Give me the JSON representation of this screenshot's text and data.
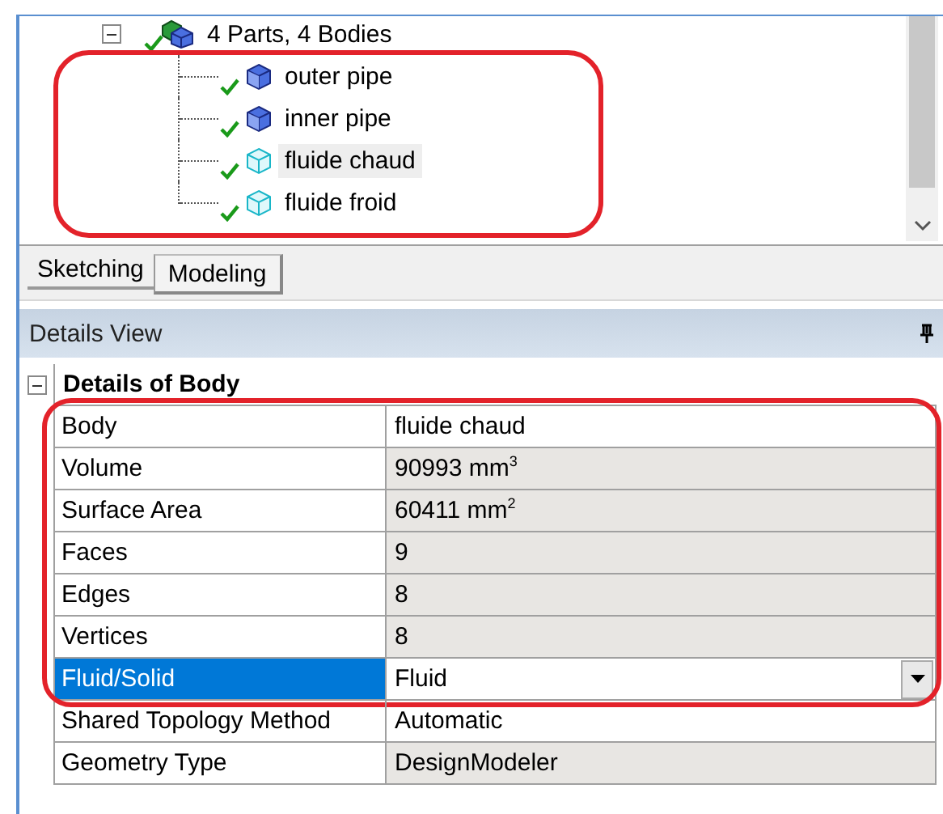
{
  "tree": {
    "outlined": true,
    "root": {
      "label": "4 Parts, 4 Bodies",
      "expanded": true,
      "children": [
        {
          "label": "outer pipe",
          "kind": "solid",
          "selected": false
        },
        {
          "label": "inner pipe",
          "kind": "solid",
          "selected": false
        },
        {
          "label": "fluide chaud",
          "kind": "fluid",
          "selected": true
        },
        {
          "label": "fluide froid",
          "kind": "fluid",
          "selected": false
        }
      ]
    }
  },
  "tabs": [
    {
      "label": "Sketching",
      "selected": false
    },
    {
      "label": "Modeling",
      "selected": true
    }
  ],
  "details_view": {
    "title": "Details View",
    "group": {
      "title": "Details of Body",
      "expanded": true,
      "sections": [
        {
          "outlined": true,
          "rows": [
            {
              "property": "Body",
              "value": "fluide chaud",
              "kind": "text",
              "readonly": false,
              "selected": false
            },
            {
              "property": "Volume",
              "value": "90993 mm$^{3}$",
              "kind": "text",
              "readonly": true,
              "selected": false
            },
            {
              "property": "Surface Area",
              "value": "60411 mm$^{2}$",
              "kind": "text",
              "readonly": true,
              "selected": false
            },
            {
              "property": "Faces",
              "value": "9",
              "kind": "text",
              "readonly": true,
              "selected": false
            },
            {
              "property": "Edges",
              "value": "8",
              "kind": "text",
              "readonly": true,
              "selected": false
            },
            {
              "property": "Vertices",
              "value": "8",
              "kind": "text",
              "readonly": true,
              "selected": false
            },
            {
              "property": "Fluid/Solid",
              "value": "Fluid",
              "kind": "dropdown",
              "readonly": false,
              "selected": true
            }
          ]
        },
        {
          "outlined": false,
          "rows": [
            {
              "property": "Shared Topology Method",
              "value": "Automatic",
              "kind": "text",
              "readonly": false,
              "selected": false
            },
            {
              "property": "Geometry Type",
              "value": "DesignModeler",
              "kind": "text",
              "readonly": true,
              "selected": false
            }
          ]
        }
      ]
    }
  }
}
